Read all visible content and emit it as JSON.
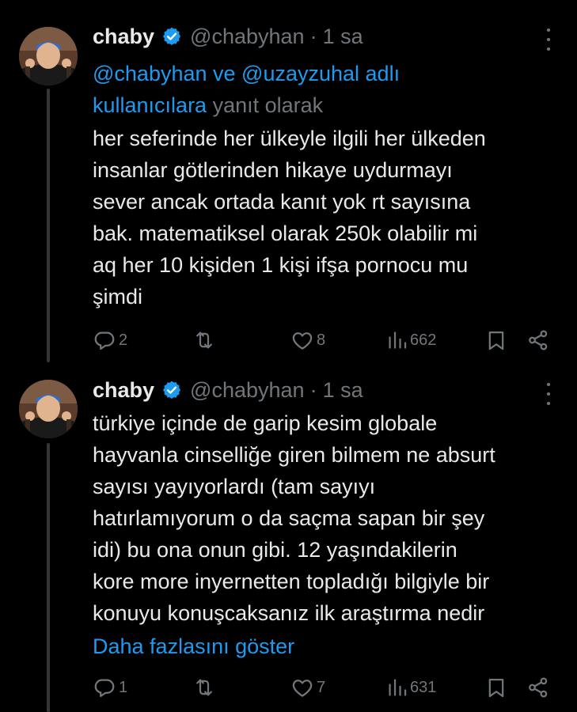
{
  "tweets": [
    {
      "display_name": "chaby",
      "handle": "@chabyhan",
      "dot": "·",
      "time": "1 sa",
      "reply_to": {
        "mention1": "@chabyhan",
        "conjunction": " ve ",
        "mention2": "@uzayzuhal adlı",
        "mention3": "kullanıcılara",
        "suffix": " yanıt olarak"
      },
      "text_lines": [
        "her seferinde her ülkeyle ilgili her ülkeden",
        "insanlar götlerinden hikaye uydurmayı",
        "sever ancak ortada kanıt yok rt sayısına",
        "bak. matematiksel olarak 250k olabilir mi",
        "aq her 10 kişiden 1 kişi ifşa pornocu mu",
        "şimdi"
      ],
      "replies": "2",
      "retweets": "",
      "likes": "8",
      "views": "662"
    },
    {
      "display_name": "chaby",
      "handle": "@chabyhan",
      "dot": "·",
      "time": "1 sa",
      "text_lines": [
        "türkiye içinde de garip kesim globale",
        "hayvanla cinselliğe giren bilmem ne absurt",
        "sayısı yayıyorlardı (tam sayıyı",
        "hatırlamıyorum o da saçma sapan bir şey",
        "idi) bu ona onun gibi. 12 yaşındakilerin",
        "kore more inyernetten topladığı bilgiyle bir",
        "konuyu konuşcaksanız ilk araştırma nedir"
      ],
      "show_more": "Daha fazlasını göster",
      "replies": "1",
      "retweets": "",
      "likes": "7",
      "views": "631"
    }
  ],
  "icons": {
    "verified": "verified-badge-icon",
    "more": "more-options-icon",
    "reply": "reply-icon",
    "retweet": "retweet-icon",
    "like": "heart-icon",
    "views": "views-chart-icon",
    "bookmark": "bookmark-icon",
    "share": "share-icon"
  },
  "colors": {
    "background": "#000000",
    "text": "#e7e9ea",
    "secondary": "#71767b",
    "accent": "#1d9bf0",
    "thread_line": "#333639"
  }
}
